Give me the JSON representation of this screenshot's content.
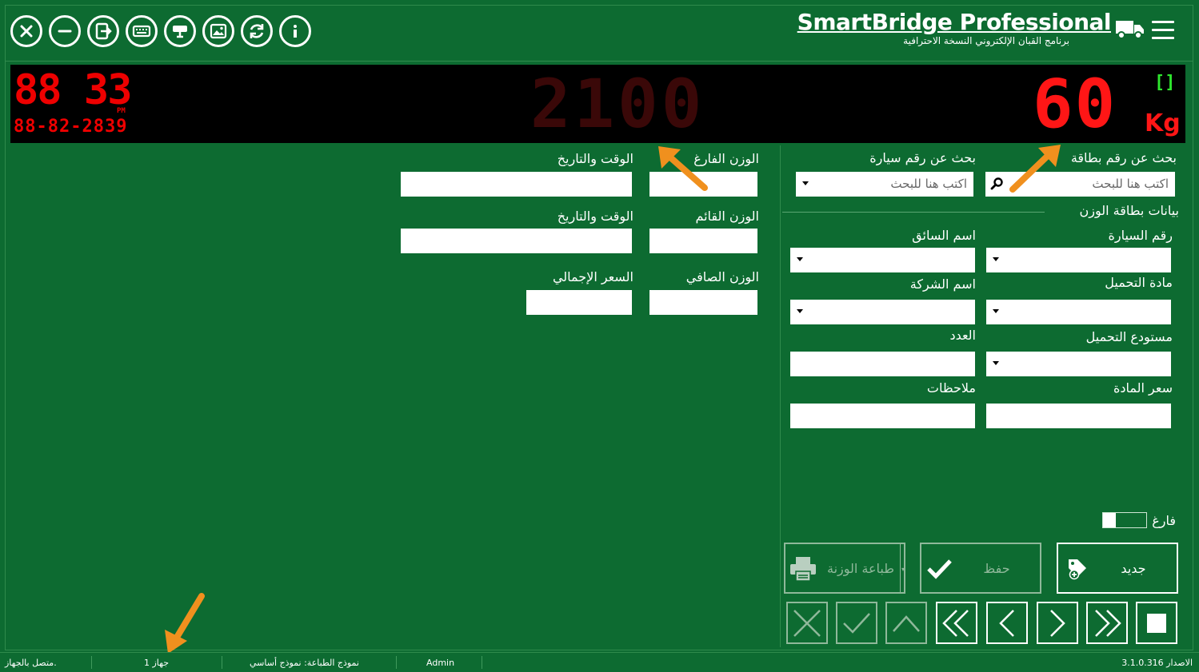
{
  "app": {
    "title": "SmartBridge Professional",
    "subtitle": "برنامج القبان الإلكتروني النسخة الاحترافية",
    "toolbar_icons": [
      "close-icon",
      "minimize-icon",
      "exit-icon",
      "keyboard-icon",
      "camera-icon",
      "image-icon",
      "refresh-icon",
      "info-icon"
    ]
  },
  "display": {
    "clock": "88 33",
    "ampm": "PM",
    "date": "88-82-2839",
    "center_weight": "2100",
    "live_weight": "60",
    "unit": "Kg",
    "indicator": "[]"
  },
  "left_panel": {
    "empty_weight_label": "الوزن الفارغ",
    "datetime_label_1": "الوقت والتاريخ",
    "full_weight_label": "الوزن القائم",
    "datetime_label_2": "الوقت والتاريخ",
    "net_weight_label": "الوزن الصافي",
    "total_price_label": "السعر الإجمالي"
  },
  "right_panel": {
    "search_card_label": "بحث عن رقم بطاقة",
    "search_card_placeholder": "اكتب هنا للبحث",
    "search_car_label": "بحث عن رقم سيارة",
    "search_car_placeholder": "اكتب هنا للبحث",
    "card_data_label": "بيانات بطاقة الوزن",
    "car_number_label": "رقم السيارة",
    "driver_name_label": "اسم السائق",
    "material_label": "مادة التحميل",
    "company_name_label": "اسم الشركة",
    "warehouse_label": "مستودع التحميل",
    "count_label": "العدد",
    "material_price_label": "سعر المادة",
    "notes_label": "ملاحظات",
    "empty_toggle_label": "فارغ"
  },
  "actions": {
    "new_label": "جديد",
    "save_label": "حفظ",
    "print_label": "طباعة الوزنة"
  },
  "status_bar": {
    "connection": "متصل بالجهاز.",
    "device": "جهاز 1",
    "print_template": "نموذج الطباعة: نموذج أساسي",
    "user": "Admin",
    "version": "الاصدار 3.1.0.316"
  },
  "colors": {
    "background": "#0d6b31",
    "display_bg": "#000000",
    "digit_red": "#ff1616",
    "digit_dim": "#3a0808",
    "indicator_green": "#2ee62e",
    "annotation_arrow": "#f0901e"
  }
}
